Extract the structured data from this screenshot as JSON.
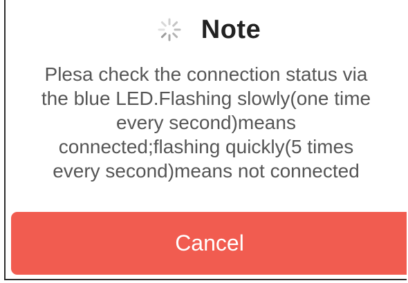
{
  "dialog": {
    "title": "Note",
    "spinner_icon": "loading-spinner-icon",
    "message_lines": [
      "Plesa check the connection status via",
      "the blue LED.Flashing slowly(one time",
      "every second)means",
      "connected;flashing quickly(5 times",
      "every second)means not connected"
    ],
    "cancel_label": "Cancel"
  },
  "colors": {
    "cancel_button": "#f15c50",
    "message_text": "#555555",
    "title_text": "#222222"
  }
}
